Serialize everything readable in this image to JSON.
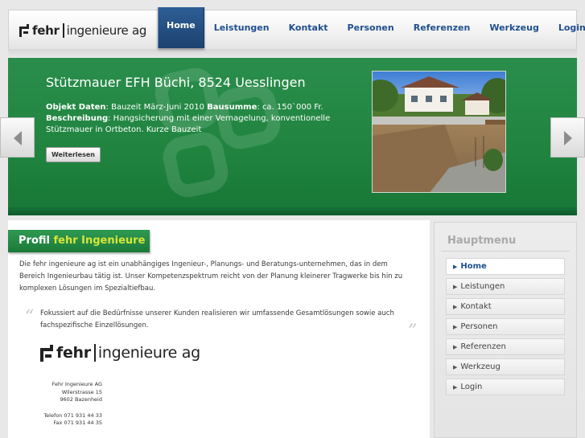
{
  "header": {
    "logo_brand": "fehr",
    "logo_rest": "ingenieure ag",
    "nav": [
      {
        "label": "Home",
        "active": true
      },
      {
        "label": "Leistungen",
        "active": false
      },
      {
        "label": "Kontakt",
        "active": false
      },
      {
        "label": "Personen",
        "active": false
      },
      {
        "label": "Referenzen",
        "active": false
      },
      {
        "label": "Werkzeug",
        "active": false
      },
      {
        "label": "Login",
        "active": false
      }
    ]
  },
  "banner": {
    "title": "Stützmauer EFH Büchi, 8524 Uesslingen",
    "objekt_label": "Objekt Daten",
    "objekt_text": "Bauzeit März-Juni 2010",
    "bausumme_label": "Bausumme",
    "bausumme_text": "ca. 150`000 Fr.",
    "beschreibung_label": "Beschreibung",
    "beschreibung_text": "Hangsicherung mit einer Vernagelung, konventionelle Stützmauer in Ortbeton. Kurze Bauzeit",
    "more_button": "Weiterlesen",
    "prev_icon": "chevron-left-icon",
    "next_icon": "chevron-right-icon"
  },
  "profil": {
    "tab_label": "Profil",
    "tab_highlight": "fehr Ingenieure",
    "intro": "Die fehr ingenieure ag ist ein unabhängiges Ingenieur-, Planungs- und Beratungs-unternehmen, das in dem Bereich Ingenieurbau tätig ist. Unser Kompetenzspektrum reicht von der Planung kleinerer Tragwerke bis hin zu komplexen Lösungen im Spezialtiefbau.",
    "quote_open": "“",
    "quote_close": "”",
    "quote": "Fokussiert auf die Bedürfnisse unserer Kunden realisieren wir umfassende Gesamtlösungen sowie auch fachspezifische Einzellösungen.",
    "card_brand": "fehr",
    "card_rest": "ingenieure ag",
    "address": [
      "Fehr Ingenieure AG",
      "Wilerstrasse 15",
      "9602 Bazenheid"
    ],
    "contact": [
      "Telefon 071 931 44 33",
      "Fax 071 931 44 35"
    ]
  },
  "sidebar": {
    "title": "Hauptmenu",
    "items": [
      {
        "label": "Home",
        "active": true
      },
      {
        "label": "Leistungen",
        "active": false
      },
      {
        "label": "Kontakt",
        "active": false
      },
      {
        "label": "Personen",
        "active": false
      },
      {
        "label": "Referenzen",
        "active": false
      },
      {
        "label": "Werkzeug",
        "active": false
      },
      {
        "label": "Login",
        "active": false
      }
    ]
  },
  "colors": {
    "brand_green": "#20843f",
    "nav_blue": "#1f4f8f",
    "accent_yellow": "#d6e63a"
  }
}
